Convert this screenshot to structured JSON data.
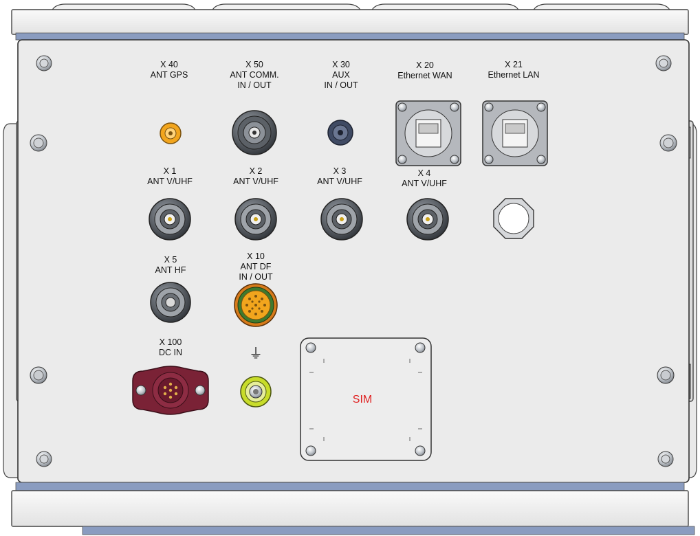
{
  "panel": {
    "connectors": [
      {
        "id": "X 40",
        "lines": [
          "X 40",
          "ANT GPS"
        ]
      },
      {
        "id": "X 50",
        "lines": [
          "X 50",
          "ANT COMM.",
          "IN / OUT"
        ]
      },
      {
        "id": "X 30",
        "lines": [
          "X 30",
          "AUX",
          "IN / OUT"
        ]
      },
      {
        "id": "X 20",
        "lines": [
          "X 20",
          "Ethernet WAN"
        ]
      },
      {
        "id": "X 21",
        "lines": [
          "X 21",
          "Ethernet LAN"
        ]
      },
      {
        "id": "X 1",
        "lines": [
          "X 1",
          "ANT V/UHF"
        ]
      },
      {
        "id": "X 2",
        "lines": [
          "X 2",
          "ANT V/UHF"
        ]
      },
      {
        "id": "X 3",
        "lines": [
          "X 3",
          "ANT V/UHF"
        ]
      },
      {
        "id": "X 4",
        "lines": [
          "X 4",
          "ANT V/UHF"
        ]
      },
      {
        "id": "X 5",
        "lines": [
          "X 5",
          "ANT HF"
        ]
      },
      {
        "id": "X 10",
        "lines": [
          "X 10",
          "ANT DF",
          "IN / OUT"
        ]
      },
      {
        "id": "X 100",
        "lines": [
          "X 100",
          "DC IN"
        ]
      }
    ],
    "ground_symbol": "⏚",
    "sim_label": "SIM"
  },
  "colors": {
    "panel": "#ebebeb",
    "frame_blue": "#7f93b8",
    "gps_connector": "#f2a51d",
    "df_connector": "#f2a51d",
    "df_ring": "#3f7a2e",
    "dc_in": "#7a2236",
    "ground_ring": "#c8dc2a",
    "sim_text": "#e02020"
  }
}
